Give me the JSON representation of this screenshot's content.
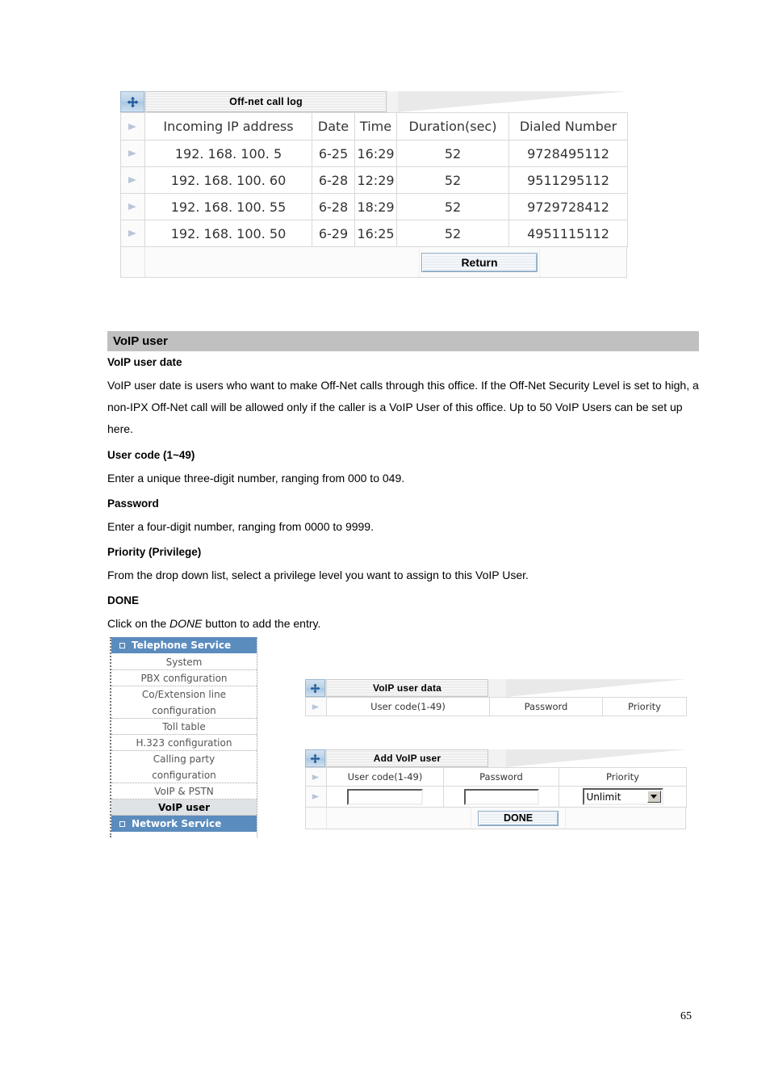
{
  "call_log_panel": {
    "icon": "move-resize-icon",
    "title": "Off-net call log",
    "columns": [
      "Incoming IP address",
      "Date",
      "Time",
      "Duration(sec)",
      "Dialed Number"
    ],
    "rows": [
      {
        "ip": "192. 168. 100. 5",
        "date": "6-25",
        "time": "16:29",
        "duration": "52",
        "dialed": "9728495112"
      },
      {
        "ip": "192. 168. 100. 60",
        "date": "6-28",
        "time": "12:29",
        "duration": "52",
        "dialed": "9511295112"
      },
      {
        "ip": "192. 168. 100. 55",
        "date": "6-28",
        "time": "18:29",
        "duration": "52",
        "dialed": "9729728412"
      },
      {
        "ip": "192. 168. 100. 50",
        "date": "6-29",
        "time": "16:25",
        "duration": "52",
        "dialed": "4951115112"
      }
    ],
    "return_button": "Return"
  },
  "section": {
    "heading": "VoIP user",
    "blocks": [
      {
        "heading": "VoIP user date",
        "body": "VoIP user date is users who want to make Off-Net calls through this office. If the Off-Net Security Level is set to high, a non-IPX Off-Net call will be allowed only if the caller is a VoIP User of this office. Up to 50 VoIP Users can be set up here."
      },
      {
        "heading": "User code (1~49)",
        "body": "Enter a unique three-digit number, ranging from 000 to 049."
      },
      {
        "heading": "Password",
        "body": "Enter a four-digit number, ranging from 0000 to 9999."
      },
      {
        "heading": "Priority (Privilege)",
        "body": "From the drop down list, select a privilege level you want to assign to this VoIP User."
      },
      {
        "heading": "DONE",
        "body_pre": "Click on the ",
        "body_em": "DONE",
        "body_post": " button to add the entry."
      }
    ]
  },
  "sidebar": {
    "groups": [
      {
        "label": "Telephone Service",
        "items": [
          {
            "label": "System",
            "selected": false
          },
          {
            "label": "PBX configuration",
            "selected": false
          },
          {
            "label": "Co/Extension line",
            "selected": false
          },
          {
            "label": "configuration",
            "selected": false
          },
          {
            "label": "Toll table",
            "selected": false
          },
          {
            "label": "H.323 configuration",
            "selected": false
          },
          {
            "label": "Calling party",
            "selected": false
          },
          {
            "label": "configuration",
            "selected": false
          },
          {
            "label": "VoIP & PSTN",
            "selected": false
          },
          {
            "label": "VoIP user",
            "selected": true
          }
        ]
      },
      {
        "label": "Network Service",
        "items": []
      }
    ]
  },
  "voip_user_data_panel": {
    "icon": "move-resize-icon",
    "title": "VoIP user data",
    "columns": [
      "User code(1-49)",
      "Password",
      "Priority"
    ]
  },
  "add_voip_user_panel": {
    "icon": "move-resize-icon",
    "title": "Add VoIP user",
    "columns": [
      "User code(1-49)",
      "Password",
      "Priority"
    ],
    "user_code_value": "",
    "password_value": "",
    "priority_value": "Unlimit",
    "done_button": "DONE"
  },
  "page_number": "65"
}
